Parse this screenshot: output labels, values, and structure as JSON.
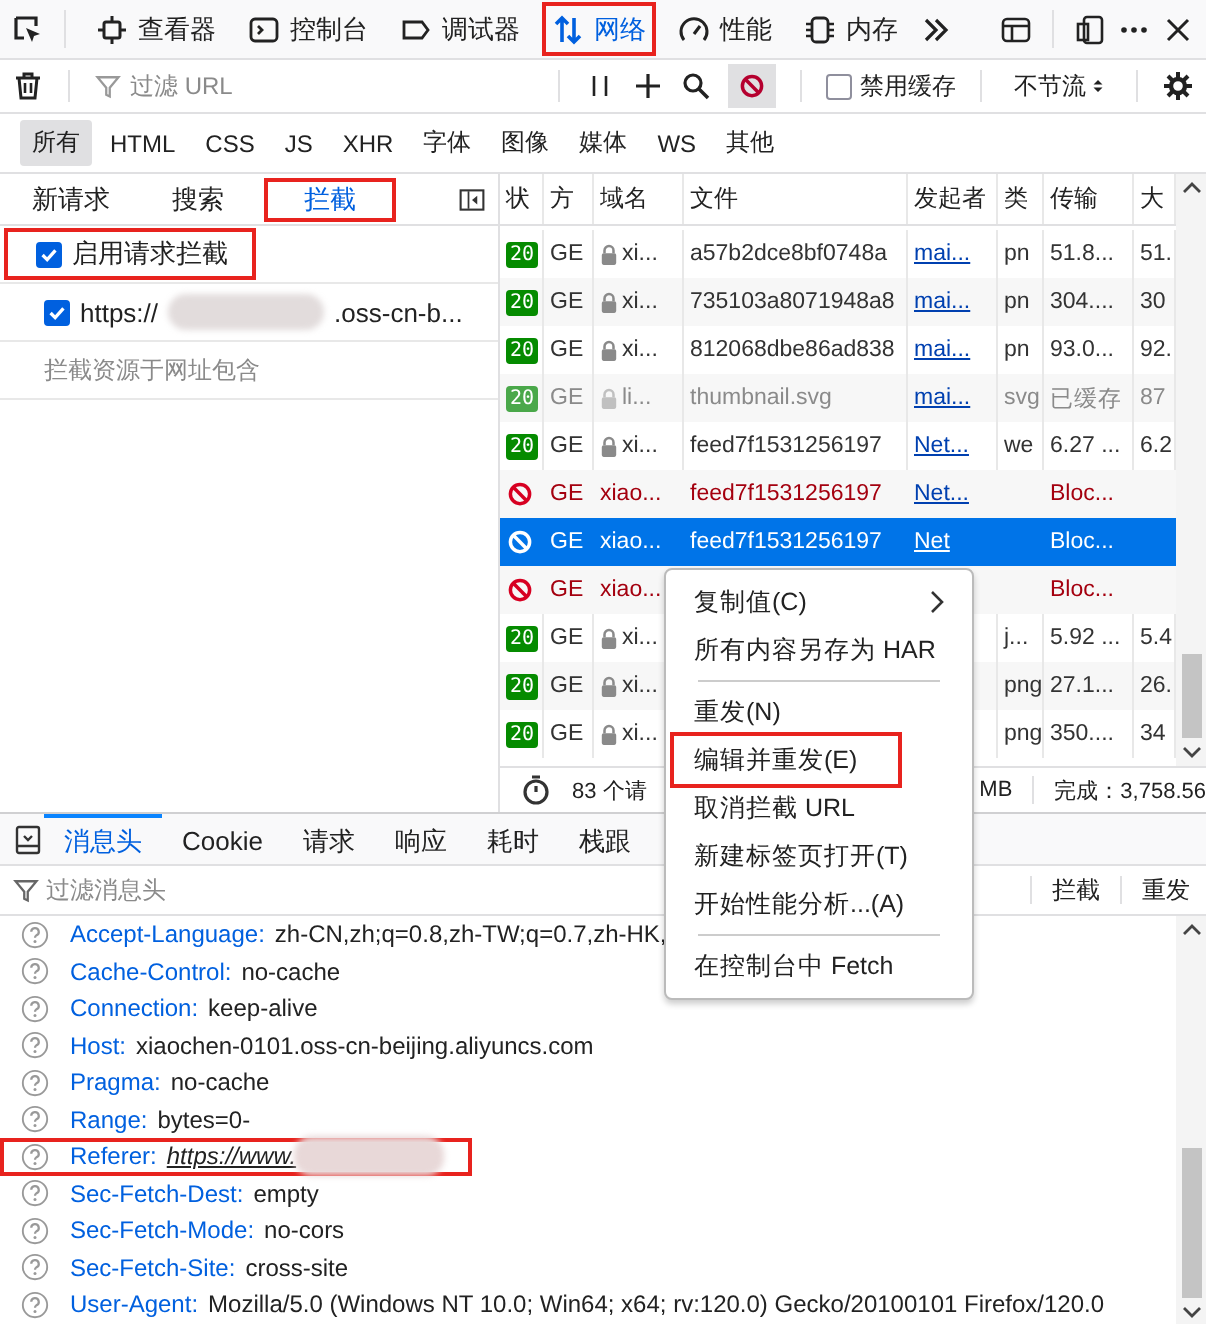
{
  "toolbar": {
    "tabs": [
      {
        "label": "查看器",
        "selected": false,
        "highlighted": false
      },
      {
        "label": "控制台",
        "selected": false,
        "highlighted": false
      },
      {
        "label": "调试器",
        "selected": false,
        "highlighted": false
      },
      {
        "label": "网络",
        "selected": true,
        "highlighted": true
      },
      {
        "label": "性能",
        "selected": false,
        "highlighted": false
      },
      {
        "label": "内存",
        "selected": false,
        "highlighted": false
      }
    ]
  },
  "filter_bar": {
    "placeholder": "过滤 URL",
    "block_active": true,
    "disable_cache": {
      "label": "禁用缓存",
      "checked": false
    },
    "throttle": "不节流"
  },
  "type_filters": [
    {
      "label": "所有",
      "selected": true
    },
    {
      "label": "HTML",
      "selected": false
    },
    {
      "label": "CSS",
      "selected": false
    },
    {
      "label": "JS",
      "selected": false
    },
    {
      "label": "XHR",
      "selected": false
    },
    {
      "label": "字体",
      "selected": false
    },
    {
      "label": "图像",
      "selected": false
    },
    {
      "label": "媒体",
      "selected": false
    },
    {
      "label": "WS",
      "selected": false
    },
    {
      "label": "其他",
      "selected": false
    }
  ],
  "side_panel": {
    "tabs": [
      {
        "label": "新请求",
        "selected": false,
        "highlighted": false
      },
      {
        "label": "搜索",
        "selected": false,
        "highlighted": false
      },
      {
        "label": "拦截",
        "selected": true,
        "highlighted": true
      }
    ],
    "enable": {
      "label": "启用请求拦截",
      "checked": true,
      "highlighted": true
    },
    "patterns": [
      {
        "prefix": "https://",
        "suffix": ".oss-cn-b...",
        "checked": true,
        "redacted": true
      }
    ],
    "placeholder": "拦截资源于网址包含"
  },
  "table": {
    "columns": [
      "状",
      "方",
      "域名",
      "文件",
      "发起者",
      "类",
      "传输",
      "大"
    ],
    "rows": [
      {
        "kind": "ok",
        "selected": false,
        "status": "20",
        "method": "GE",
        "secure": true,
        "domain": "xi...",
        "file": "a57b2dce8bf0748a",
        "initiator": "mai...",
        "type": "pn",
        "transfer": "51.8...",
        "size": "51."
      },
      {
        "kind": "ok",
        "selected": false,
        "status": "20",
        "method": "GE",
        "secure": true,
        "domain": "xi...",
        "file": "735103a8071948a8",
        "initiator": "mai...",
        "type": "pn",
        "transfer": "304....",
        "size": "30"
      },
      {
        "kind": "ok",
        "selected": false,
        "status": "20",
        "method": "GE",
        "secure": true,
        "domain": "xi...",
        "file": "812068dbe86ad838",
        "initiator": "mai...",
        "type": "pn",
        "transfer": "93.0...",
        "size": "92."
      },
      {
        "kind": "cached",
        "selected": false,
        "status": "20",
        "method": "GE",
        "secure": true,
        "domain": "li...",
        "file": "thumbnail.svg",
        "initiator": "mai...",
        "type": "svg",
        "transfer": "已缓存",
        "size": "87"
      },
      {
        "kind": "ok",
        "selected": false,
        "status": "20",
        "method": "GE",
        "secure": true,
        "domain": "xi...",
        "file": "feed7f1531256197",
        "initiator": "Net...",
        "type": "we",
        "transfer": "6.27 ...",
        "size": "6.2"
      },
      {
        "kind": "blocked",
        "selected": false,
        "method": "GE",
        "domain": "xiao...",
        "file": "feed7f1531256197",
        "initiator": "Net...",
        "transfer": "Bloc..."
      },
      {
        "kind": "blocked",
        "selected": true,
        "method": "GE",
        "domain": "xiao...",
        "file": "feed7f1531256197",
        "initiator": "Net",
        "transfer": "Bloc..."
      },
      {
        "kind": "blocked",
        "selected": false,
        "method": "GE",
        "domain": "xiao...",
        "transfer": "Bloc..."
      },
      {
        "kind": "ok",
        "selected": false,
        "status": "20",
        "method": "GE",
        "secure": true,
        "domain": "xi...",
        "type": "j...",
        "transfer": "5.92 ...",
        "size": "5.4"
      },
      {
        "kind": "ok",
        "selected": false,
        "status": "20",
        "method": "GE",
        "secure": true,
        "domain": "xi...",
        "type": "png",
        "transfer": "27.1...",
        "size": "26."
      },
      {
        "kind": "ok",
        "selected": false,
        "status": "20",
        "method": "GE",
        "secure": true,
        "domain": "xi...",
        "type": "png",
        "transfer": "350....",
        "size": "34"
      }
    ]
  },
  "status_bar": {
    "requests": "83 个请",
    "size": "MB",
    "finish": "完成：3,758.56"
  },
  "details": {
    "tabs": [
      {
        "label": "消息头",
        "selected": true
      },
      {
        "label": "Cookie",
        "selected": false
      },
      {
        "label": "请求",
        "selected": false
      },
      {
        "label": "响应",
        "selected": false
      },
      {
        "label": "耗时",
        "selected": false
      },
      {
        "label": "栈跟",
        "selected": false
      }
    ],
    "placeholder": "过滤消息头",
    "actions": [
      "拦截",
      "重发"
    ],
    "headers": [
      {
        "name": "Accept-Language:",
        "value": "zh-CN,zh;q=0.8,zh-TW;q=0.7,zh-HK,"
      },
      {
        "name": "Cache-Control:",
        "value": "no-cache"
      },
      {
        "name": "Connection:",
        "value": "keep-alive"
      },
      {
        "name": "Host:",
        "value": "xiaochen-0101.oss-cn-beijing.aliyuncs.com"
      },
      {
        "name": "Pragma:",
        "value": "no-cache"
      },
      {
        "name": "Range:",
        "value": "bytes=0-"
      },
      {
        "name": "Referer:",
        "value": "https://www.",
        "link": true,
        "redacted": true,
        "highlighted": true
      },
      {
        "name": "Sec-Fetch-Dest:",
        "value": "empty"
      },
      {
        "name": "Sec-Fetch-Mode:",
        "value": "no-cors"
      },
      {
        "name": "Sec-Fetch-Site:",
        "value": "cross-site"
      },
      {
        "name": "User-Agent:",
        "value": "Mozilla/5.0 (Windows NT 10.0; Win64; x64; rv:120.0) Gecko/20100101 Firefox/120.0"
      }
    ]
  },
  "context_menu": [
    {
      "kind": "item",
      "label": "复制值(C)",
      "submenu": true,
      "highlighted": false
    },
    {
      "kind": "item",
      "label": "所有内容另存为 HAR",
      "highlighted": false
    },
    {
      "kind": "separator"
    },
    {
      "kind": "item",
      "label": "重发(N)",
      "highlighted": false
    },
    {
      "kind": "item",
      "label": "编辑并重发(E)",
      "highlighted": true
    },
    {
      "kind": "item",
      "label": "取消拦截 URL",
      "highlighted": false
    },
    {
      "kind": "item",
      "label": "新建标签页打开(T)",
      "highlighted": false
    },
    {
      "kind": "item",
      "label": "开始性能分析...(A)",
      "highlighted": false
    },
    {
      "kind": "separator"
    },
    {
      "kind": "item",
      "label": "在控制台中 Fetch",
      "highlighted": false
    }
  ]
}
